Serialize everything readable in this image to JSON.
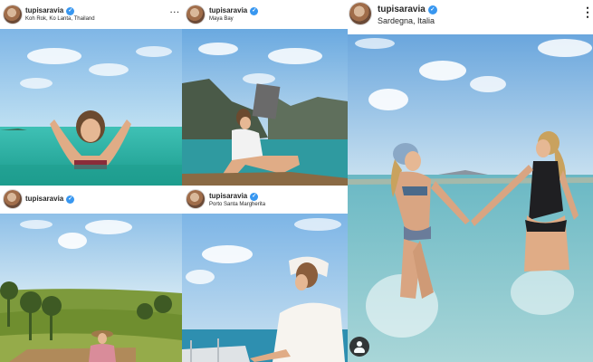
{
  "posts": [
    {
      "username": "tupisaravia",
      "location": "Koh Rok, Ko Lanta, Thailand",
      "verified_icon": "verified-badge-icon",
      "more_label": "···"
    },
    {
      "username": "tupisaravia",
      "location": "Maya Bay",
      "verified_icon": "verified-badge-icon"
    },
    {
      "username": "tupisaravia",
      "location": "",
      "verified_icon": "verified-badge-icon"
    },
    {
      "username": "tupisaravia",
      "location": "Porto Santa Margherita",
      "verified_icon": "verified-badge-icon"
    },
    {
      "username": "tupisaravia",
      "location": "Sardegna, Italia",
      "verified_icon": "verified-badge-icon",
      "more_label": "⋮",
      "tagged_icon": "user-tag-icon"
    }
  ],
  "colors": {
    "verified": "#3897f0",
    "text": "#262626"
  }
}
